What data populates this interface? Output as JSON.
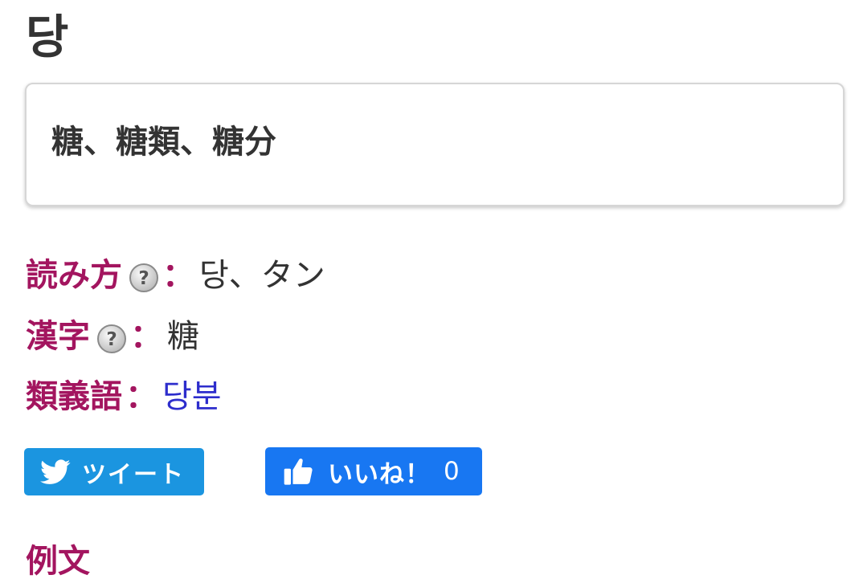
{
  "entry": {
    "headword": "당",
    "meaning": "糖、糖類、糖分"
  },
  "details": {
    "reading": {
      "label": "読み方",
      "colon": "：",
      "value": "당、タン",
      "help_icon": "question-mark-icon"
    },
    "kanji": {
      "label": "漢字",
      "colon": "：",
      "value": "糖",
      "help_icon": "question-mark-icon"
    },
    "synonym": {
      "label": "類義語",
      "colon": "：",
      "value": "당분"
    }
  },
  "share": {
    "tweet_label": "ツイート",
    "tweet_icon": "twitter-bird-icon",
    "tweet_color": "#1b95e0",
    "like_label": "いいね！",
    "like_count": "0",
    "like_icon": "thumbs-up-icon",
    "like_color": "#1877f2"
  },
  "next_section": {
    "heading": "例文"
  },
  "colors": {
    "label_accent": "#a3155f",
    "link": "#2d2dcc",
    "text": "#333333"
  }
}
